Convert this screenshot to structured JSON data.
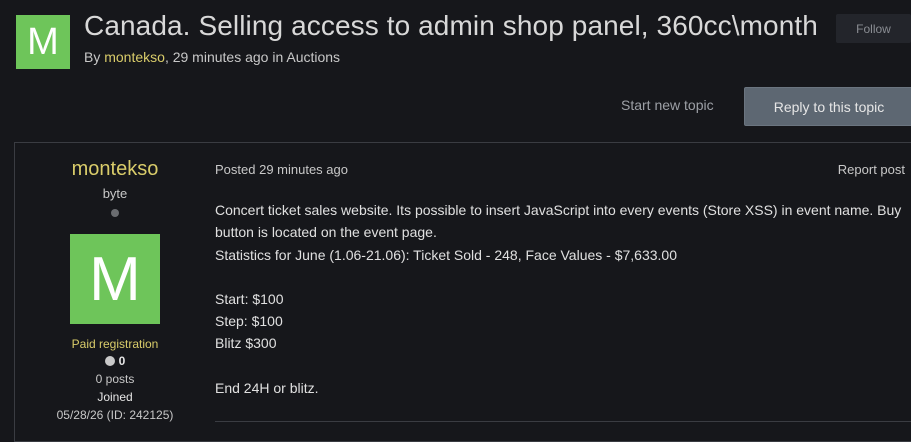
{
  "topic": {
    "avatar_letter": "M",
    "title": "Canada. Selling access to admin shop panel, 360cc\\month",
    "byline_prefix": "By ",
    "author": "montekso",
    "byline_time": ", 29 minutes ago in ",
    "forum": "Auctions",
    "follow_label": "Follow"
  },
  "actions": {
    "start_new_topic": "Start new topic",
    "reply_label": "Reply to this topic"
  },
  "post": {
    "author": {
      "name": "montekso",
      "rank": "byte",
      "avatar_letter": "M",
      "group": "Paid registration",
      "reputation": "0",
      "posts": "0 posts",
      "joined_label": "Joined",
      "joined_date": "05/28/26 (ID: 242125)"
    },
    "posted": "Posted 29 minutes ago",
    "report_label": "Report post",
    "body": {
      "line1": "Concert ticket sales website. Its possible to insert JavaScript into every events (Store XSS) in event name. Buy button is located on the event page.",
      "line2": "Statistics for June (1.06-21.06): Ticket Sold - 248, Face Values - $7,633.00",
      "start": "Start: $100",
      "step": "Step: $100",
      "blitz": "Blitz $300",
      "end": "End 24H or blitz."
    }
  },
  "colors": {
    "background": "#16171b",
    "accent_gold": "#d9cc6a",
    "avatar_green": "#6ec55a",
    "reply_button": "#5d6772"
  }
}
